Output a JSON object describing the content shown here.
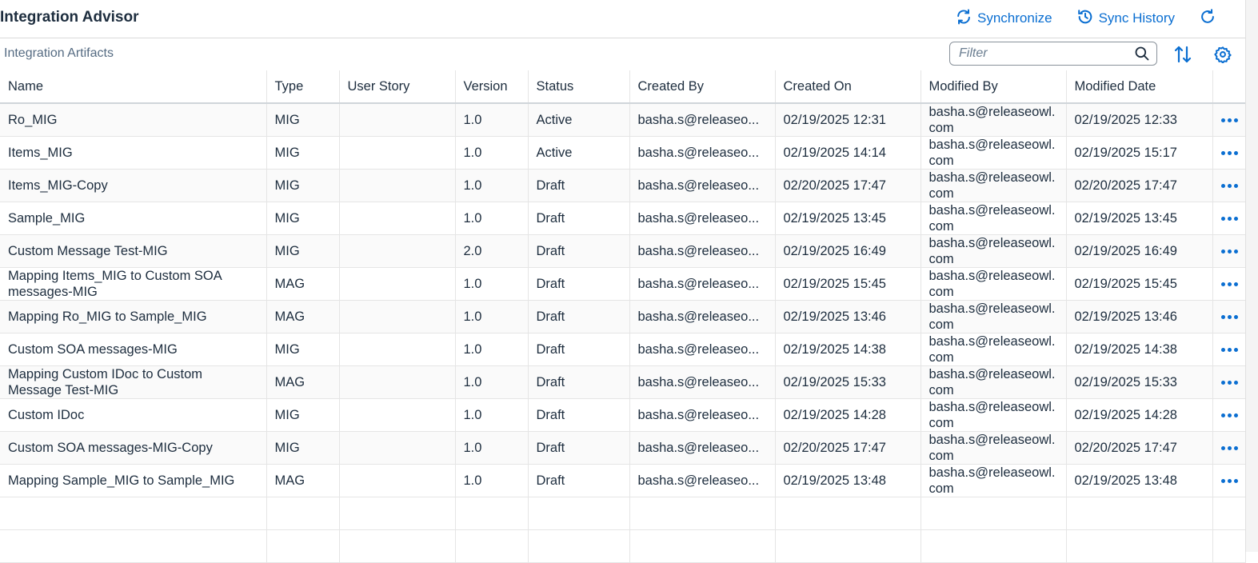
{
  "header": {
    "title": "Integration Advisor",
    "synchronize_label": "Synchronize",
    "sync_history_label": "Sync History"
  },
  "toolbar": {
    "section_title": "Integration Artifacts",
    "filter_placeholder": "Filter"
  },
  "colors": {
    "accent": "#0a6ed1",
    "text": "#1d2d3e",
    "muted": "#556b82"
  },
  "icons": [
    "refresh-icon",
    "history-icon",
    "reload-icon",
    "search-icon",
    "sort-icon",
    "settings-icon",
    "more-icon"
  ],
  "table": {
    "columns": [
      "Name",
      "Type",
      "User Story",
      "Version",
      "Status",
      "Created By",
      "Created On",
      "Modified By",
      "Modified Date"
    ],
    "rows": [
      {
        "name": "Ro_MIG",
        "type": "MIG",
        "user_story": "",
        "version": "1.0",
        "status": "Active",
        "created_by": "basha.s@releaseo...",
        "created_on": "02/19/2025 12:31",
        "modified_by": "basha.s@releaseowl.com",
        "modified_date": "02/19/2025 12:33"
      },
      {
        "name": "Items_MIG",
        "type": "MIG",
        "user_story": "",
        "version": "1.0",
        "status": "Active",
        "created_by": "basha.s@releaseo...",
        "created_on": "02/19/2025 14:14",
        "modified_by": "basha.s@releaseowl.com",
        "modified_date": "02/19/2025 15:17"
      },
      {
        "name": "Items_MIG-Copy",
        "type": "MIG",
        "user_story": "",
        "version": "1.0",
        "status": "Draft",
        "created_by": "basha.s@releaseo...",
        "created_on": "02/20/2025 17:47",
        "modified_by": "basha.s@releaseowl.com",
        "modified_date": "02/20/2025 17:47"
      },
      {
        "name": "Sample_MIG",
        "type": "MIG",
        "user_story": "",
        "version": "1.0",
        "status": "Draft",
        "created_by": "basha.s@releaseo...",
        "created_on": "02/19/2025 13:45",
        "modified_by": "basha.s@releaseowl.com",
        "modified_date": "02/19/2025 13:45"
      },
      {
        "name": "Custom Message Test-MIG",
        "type": "MIG",
        "user_story": "",
        "version": "2.0",
        "status": "Draft",
        "created_by": "basha.s@releaseo...",
        "created_on": "02/19/2025 16:49",
        "modified_by": "basha.s@releaseowl.com",
        "modified_date": "02/19/2025 16:49"
      },
      {
        "name": "Mapping Items_MIG to Custom SOA messages-MIG",
        "type": "MAG",
        "user_story": "",
        "version": "1.0",
        "status": "Draft",
        "created_by": "basha.s@releaseo...",
        "created_on": "02/19/2025 15:45",
        "modified_by": "basha.s@releaseowl.com",
        "modified_date": "02/19/2025 15:45"
      },
      {
        "name": "Mapping Ro_MIG to Sample_MIG",
        "type": "MAG",
        "user_story": "",
        "version": "1.0",
        "status": "Draft",
        "created_by": "basha.s@releaseo...",
        "created_on": "02/19/2025 13:46",
        "modified_by": "basha.s@releaseowl.com",
        "modified_date": "02/19/2025 13:46"
      },
      {
        "name": "Custom SOA messages-MIG",
        "type": "MIG",
        "user_story": "",
        "version": "1.0",
        "status": "Draft",
        "created_by": "basha.s@releaseo...",
        "created_on": "02/19/2025 14:38",
        "modified_by": "basha.s@releaseowl.com",
        "modified_date": "02/19/2025 14:38"
      },
      {
        "name": "Mapping Custom IDoc to Custom Message Test-MIG",
        "type": "MAG",
        "user_story": "",
        "version": "1.0",
        "status": "Draft",
        "created_by": "basha.s@releaseo...",
        "created_on": "02/19/2025 15:33",
        "modified_by": "basha.s@releaseowl.com",
        "modified_date": "02/19/2025 15:33"
      },
      {
        "name": "Custom IDoc",
        "type": "MIG",
        "user_story": "",
        "version": "1.0",
        "status": "Draft",
        "created_by": "basha.s@releaseo...",
        "created_on": "02/19/2025 14:28",
        "modified_by": "basha.s@releaseowl.com",
        "modified_date": "02/19/2025 14:28"
      },
      {
        "name": "Custom SOA messages-MIG-Copy",
        "type": "MIG",
        "user_story": "",
        "version": "1.0",
        "status": "Draft",
        "created_by": "basha.s@releaseo...",
        "created_on": "02/20/2025 17:47",
        "modified_by": "basha.s@releaseowl.com",
        "modified_date": "02/20/2025 17:47"
      },
      {
        "name": "Mapping Sample_MIG to Sample_MIG",
        "type": "MAG",
        "user_story": "",
        "version": "1.0",
        "status": "Draft",
        "created_by": "basha.s@releaseo...",
        "created_on": "02/19/2025 13:48",
        "modified_by": "basha.s@releaseowl.com",
        "modified_date": "02/19/2025 13:48"
      }
    ]
  }
}
